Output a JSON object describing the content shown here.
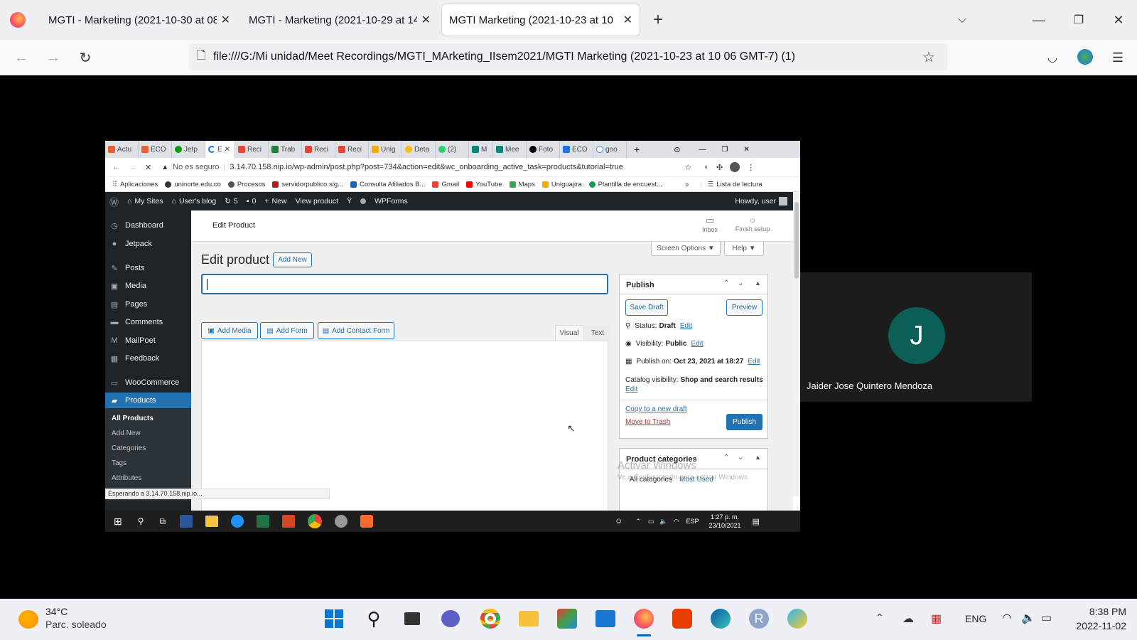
{
  "browser": {
    "tabs": [
      {
        "title": "MGTI - Marketing (2021-10-30 at 08",
        "active": false
      },
      {
        "title": "MGTI - Marketing (2021-10-29 at 14",
        "active": false
      },
      {
        "title": "MGTI Marketing (2021-10-23 at 10",
        "active": true
      }
    ],
    "url": "file:///G:/Mi unidad/Meet Recordings/MGTI_MArketing_IIsem2021/MGTI Marketing (2021-10-23 at 10 06 GMT-7) (1)"
  },
  "inner_browser": {
    "tabs": [
      "Actu",
      "ECO",
      "Jetp",
      "E",
      "Reci",
      "Trab",
      "Reci",
      "Reci",
      "Unig",
      "Deta",
      "(2)",
      "M",
      "Mee",
      "Foto",
      "ECO",
      "goo"
    ],
    "security_label": "No es seguro",
    "url": "3.14.70.158.nip.io/wp-admin/post.php?post=734&action=edit&wc_onboarding_active_task=products&tutorial=true",
    "bookmarks": [
      "Aplicaciones",
      "uninorte.edu.co",
      "Procesos",
      "servidorpublico.sig...",
      "Consulta Afiliados B...",
      "Gmail",
      "YouTube",
      "Maps",
      "Uniguajira",
      "Plantilla de encuest..."
    ],
    "reading_list": "Lista de lectura",
    "status_text": "Esperando a 3.14.70.158.nip.io..."
  },
  "admin_bar": {
    "my_sites": "My Sites",
    "blog": "User's blog",
    "updates": "5",
    "comments": "0",
    "new": "New",
    "view_product": "View product",
    "wpforms": "WPForms",
    "howdy": "Howdy, user"
  },
  "sidebar": {
    "items": [
      "Dashboard",
      "Jetpack",
      "Posts",
      "Media",
      "Pages",
      "Comments",
      "MailPoet",
      "Feedback",
      "WooCommerce",
      "Products"
    ],
    "sub_items": [
      "All Products",
      "Add New",
      "Categories",
      "Tags",
      "Attributes"
    ]
  },
  "header": {
    "title": "Edit Product",
    "inbox": "Inbox",
    "finish_setup": "Finish setup"
  },
  "screen_options": "Screen Options ▼",
  "help": "Help ▼",
  "page_title": "Edit product",
  "add_new": "Add New",
  "editor": {
    "add_media": "Add Media",
    "add_form": "Add Form",
    "add_contact_form": "Add Contact Form",
    "visual": "Visual",
    "text": "Text"
  },
  "publish": {
    "title": "Publish",
    "save_draft": "Save Draft",
    "preview": "Preview",
    "status_label": "Status:",
    "status_value": "Draft",
    "visibility_label": "Visibility:",
    "visibility_value": "Public",
    "publish_on_label": "Publish on:",
    "publish_on_value": "Oct 23, 2021 at 18:27",
    "edit": "Edit",
    "catalog_label": "Catalog visibility:",
    "catalog_value": "Shop and search results",
    "copy_draft": "Copy to a new draft",
    "trash": "Move to Trash",
    "publish_button": "Publish"
  },
  "categories": {
    "title": "Product categories",
    "all": "All categories",
    "most_used": "Most Used"
  },
  "watermark": {
    "line1": "Activar Windows",
    "line2": "Ve a Configuración para activar Windows."
  },
  "inner_taskbar": {
    "lang": "ESP",
    "time": "1:27 p. m.",
    "date": "23/10/2021"
  },
  "participant": {
    "initial": "J",
    "name": "Jaider Jose Quintero Mendoza"
  },
  "os_taskbar": {
    "temp": "34°C",
    "weather": "Parc. soleado",
    "lang": "ENG",
    "time": "8:38 PM",
    "date": "2022-11-02"
  }
}
